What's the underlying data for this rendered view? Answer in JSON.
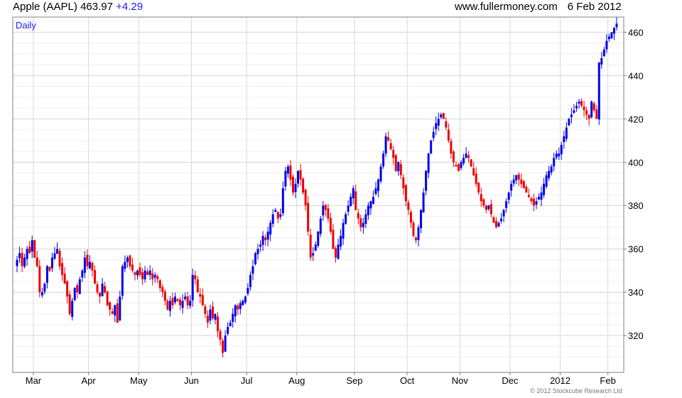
{
  "header": {
    "symbol": "Apple (AAPL)",
    "last": "463.97",
    "change": "+4.29",
    "site": "www.fullermoney.com",
    "date": "6 Feb 2012"
  },
  "frequency_label": "Daily",
  "copyright": "© 2012 Stockcube Research Ltd",
  "colors": {
    "up": "#0000ee",
    "down": "#ee0000",
    "grid": "#d8d8d8",
    "frame": "#808080"
  },
  "chart_data": {
    "type": "candlestick",
    "x_tick_labels": [
      "Mar",
      "Apr",
      "May",
      "Jun",
      "Jul",
      "Aug",
      "Sep",
      "Oct",
      "Nov",
      "Dec",
      "2012",
      "Feb"
    ],
    "y_ticks": [
      320,
      340,
      360,
      380,
      400,
      420,
      440,
      460
    ],
    "ylim": [
      303,
      467
    ],
    "y_axis_side": "right",
    "grid": true,
    "series": [
      {
        "month": "Feb 2011",
        "close": [
          355,
          358,
          352,
          356,
          360,
          358,
          364
        ]
      },
      {
        "month": "Mar 2011",
        "close": [
          356,
          352,
          340,
          340,
          344,
          352,
          350,
          356,
          358,
          360,
          352,
          348,
          344,
          338,
          330,
          336,
          342,
          340,
          346,
          350,
          356,
          352
        ]
      },
      {
        "month": "Apr 2011",
        "close": [
          354,
          350,
          344,
          340,
          338,
          344,
          340,
          334,
          332,
          330,
          334,
          326,
          338,
          352,
          354,
          356,
          352,
          350,
          348,
          350
        ]
      },
      {
        "month": "May 2011",
        "close": [
          348,
          346,
          350,
          348,
          350,
          346,
          348,
          346,
          342,
          340,
          336,
          332,
          336,
          334,
          338,
          336,
          334,
          336,
          338,
          334,
          336
        ]
      },
      {
        "month": "Jun 2011",
        "close": [
          348,
          346,
          340,
          338,
          334,
          330,
          326,
          332,
          328,
          330,
          322,
          318,
          312,
          320,
          324,
          326,
          330,
          334,
          332,
          335,
          336,
          338
        ]
      },
      {
        "month": "Jul 2011",
        "close": [
          342,
          348,
          352,
          358,
          360,
          362,
          366,
          364,
          368,
          372,
          376,
          378,
          374,
          376,
          388,
          396,
          398,
          392,
          386,
          390
        ]
      },
      {
        "month": "Aug 2011",
        "close": [
          396,
          392,
          386,
          380,
          368,
          356,
          358,
          362,
          368,
          374,
          380,
          378,
          374,
          368,
          360,
          356,
          362,
          366,
          372,
          376,
          380,
          384,
          388
        ]
      },
      {
        "month": "Sep 2011",
        "close": [
          378,
          374,
          370,
          372,
          376,
          380,
          382,
          384,
          388,
          392,
          398,
          404,
          412,
          410,
          406,
          402,
          396,
          400,
          394,
          388,
          382
        ]
      },
      {
        "month": "Oct 2011",
        "close": [
          378,
          372,
          366,
          364,
          370,
          378,
          386,
          396,
          404,
          410,
          414,
          418,
          420,
          422,
          420,
          416,
          410,
          404,
          400,
          398,
          396
        ]
      },
      {
        "month": "Nov 2011",
        "close": [
          400,
          402,
          404,
          402,
          398,
          394,
          390,
          386,
          382,
          380,
          378,
          380,
          376,
          372,
          370,
          372,
          374,
          378,
          382,
          386
        ]
      },
      {
        "month": "Dec 2011",
        "close": [
          390,
          392,
          394,
          392,
          390,
          388,
          386,
          384,
          382,
          380,
          382,
          384,
          386,
          390,
          394,
          396,
          398,
          402,
          404,
          404
        ]
      },
      {
        "month": "Jan 2012",
        "close": [
          408,
          412,
          416,
          420,
          422,
          424,
          426,
          428,
          426,
          424,
          422,
          420,
          428,
          424,
          420,
          446,
          448,
          452,
          456
        ]
      },
      {
        "month": "Feb 2012",
        "close": [
          458,
          460,
          462,
          464
        ]
      }
    ]
  }
}
